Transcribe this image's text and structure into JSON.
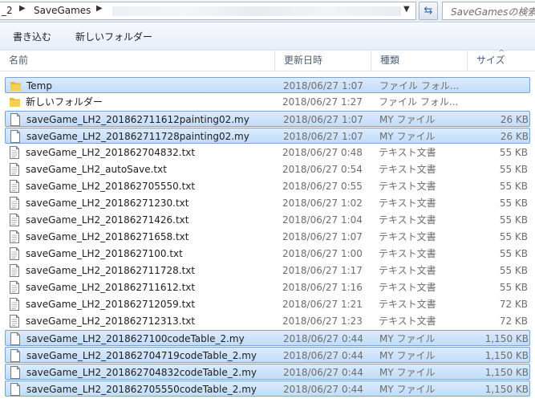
{
  "address_bar": {
    "crumbs": [
      "_2",
      "SaveGames"
    ],
    "search_placeholder": "SaveGamesの検索"
  },
  "toolbar": {
    "burn_label": "書き込む",
    "new_folder_label": "新しいフォルダー"
  },
  "columns": {
    "name": "名前",
    "date": "更新日時",
    "type": "種類",
    "size": "サイズ"
  },
  "files": [
    {
      "name": "Temp",
      "date": "2018/06/27 1:07",
      "type": "ファイル フォル...",
      "size": "",
      "icon": "folder-icon",
      "selected": true
    },
    {
      "name": "新しいフォルダー",
      "date": "2018/06/27 1:27",
      "type": "ファイル フォル...",
      "size": "",
      "icon": "folder-icon",
      "selected": false
    },
    {
      "name": "saveGame_LH2_201862711612painting02.my",
      "date": "2018/06/27 1:07",
      "type": "MY ファイル",
      "size": "26 KB",
      "icon": "file-icon",
      "selected": true
    },
    {
      "name": "saveGame_LH2_201862711728painting02.my",
      "date": "2018/06/27 1:07",
      "type": "MY ファイル",
      "size": "26 KB",
      "icon": "file-icon",
      "selected": true
    },
    {
      "name": "saveGame_LH2_201862704832.txt",
      "date": "2018/06/27 0:48",
      "type": "テキスト文書",
      "size": "55 KB",
      "icon": "text-file-icon",
      "selected": false
    },
    {
      "name": "saveGame_LH2_autoSave.txt",
      "date": "2018/06/27 0:54",
      "type": "テキスト文書",
      "size": "55 KB",
      "icon": "text-file-icon",
      "selected": false
    },
    {
      "name": "saveGame_LH2_201862705550.txt",
      "date": "2018/06/27 0:55",
      "type": "テキスト文書",
      "size": "55 KB",
      "icon": "text-file-icon",
      "selected": false
    },
    {
      "name": "saveGame_LH2_20186271230.txt",
      "date": "2018/06/27 1:02",
      "type": "テキスト文書",
      "size": "55 KB",
      "icon": "text-file-icon",
      "selected": false
    },
    {
      "name": "saveGame_LH2_20186271426.txt",
      "date": "2018/06/27 1:04",
      "type": "テキスト文書",
      "size": "55 KB",
      "icon": "text-file-icon",
      "selected": false
    },
    {
      "name": "saveGame_LH2_20186271658.txt",
      "date": "2018/06/27 1:07",
      "type": "テキスト文書",
      "size": "55 KB",
      "icon": "text-file-icon",
      "selected": false
    },
    {
      "name": "saveGame_LH2_2018627100.txt",
      "date": "2018/06/27 1:00",
      "type": "テキスト文書",
      "size": "55 KB",
      "icon": "text-file-icon",
      "selected": false
    },
    {
      "name": "saveGame_LH2_201862711728.txt",
      "date": "2018/06/27 1:17",
      "type": "テキスト文書",
      "size": "55 KB",
      "icon": "text-file-icon",
      "selected": false
    },
    {
      "name": "saveGame_LH2_201862711612.txt",
      "date": "2018/06/27 1:16",
      "type": "テキスト文書",
      "size": "55 KB",
      "icon": "text-file-icon",
      "selected": false
    },
    {
      "name": "saveGame_LH2_201862712059.txt",
      "date": "2018/06/27 1:21",
      "type": "テキスト文書",
      "size": "72 KB",
      "icon": "text-file-icon",
      "selected": false
    },
    {
      "name": "saveGame_LH2_201862712313.txt",
      "date": "2018/06/27 1:23",
      "type": "テキスト文書",
      "size": "72 KB",
      "icon": "text-file-icon",
      "selected": false
    },
    {
      "name": "saveGame_LH2_2018627100codeTable_2.my",
      "date": "2018/06/27 0:44",
      "type": "MY ファイル",
      "size": "1,150 KB",
      "icon": "file-icon",
      "selected": true
    },
    {
      "name": "saveGame_LH2_201862704719codeTable_2.my",
      "date": "2018/06/27 0:44",
      "type": "MY ファイル",
      "size": "1,150 KB",
      "icon": "file-icon",
      "selected": true
    },
    {
      "name": "saveGame_LH2_201862704832codeTable_2.my",
      "date": "2018/06/27 0:44",
      "type": "MY ファイル",
      "size": "1,150 KB",
      "icon": "file-icon",
      "selected": true
    },
    {
      "name": "saveGame_LH2_201862705550codeTable_2.my",
      "date": "2018/06/27 0:44",
      "type": "MY ファイル",
      "size": "1,150 KB",
      "icon": "file-icon",
      "selected": true
    }
  ],
  "colors": {
    "selection_fill": "#cce4fc",
    "selection_border": "#7da2ce",
    "folder": "#e8b739"
  }
}
